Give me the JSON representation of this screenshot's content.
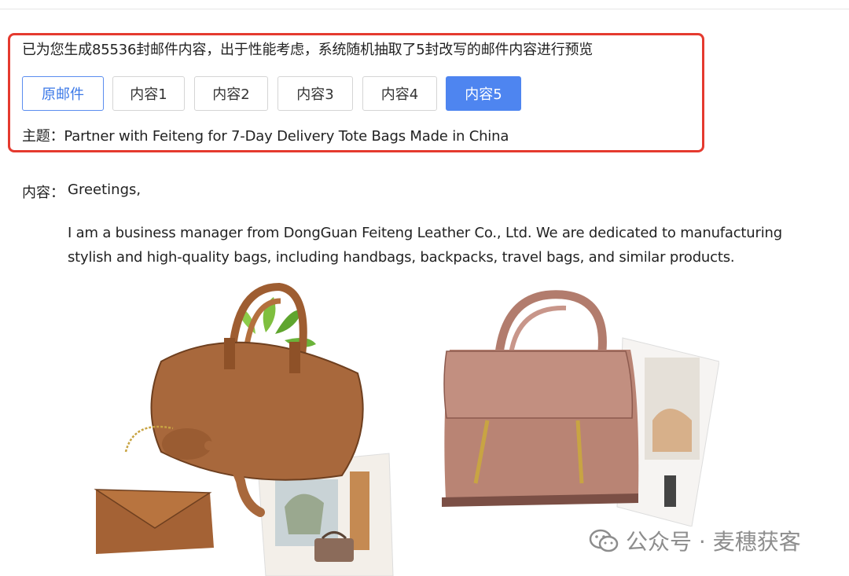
{
  "summary": "已为您生成85536封邮件内容，出于性能考虑，系统随机抽取了5封改写的邮件内容进行预览",
  "tabs": [
    {
      "label": "原邮件",
      "state": "original"
    },
    {
      "label": "内容1",
      "state": "default"
    },
    {
      "label": "内容2",
      "state": "default"
    },
    {
      "label": "内容3",
      "state": "default"
    },
    {
      "label": "内容4",
      "state": "default"
    },
    {
      "label": "内容5",
      "state": "active"
    }
  ],
  "subject": {
    "label": "主题：",
    "value": "Partner with Feiteng for 7-Day Delivery Tote Bags Made in China"
  },
  "email": {
    "content_label": "内容：",
    "greeting": "Greetings,",
    "paragraph": "I am a business manager from DongGuan Feiteng Leather Co., Ltd. We are dedicated to manufacturing stylish and high-quality bags, including handbags, backpacks, travel bags, and similar products."
  },
  "watermark": {
    "text": "公众号 · 麦穗获客",
    "icon": "wechat-icon"
  },
  "colors": {
    "highlight_border": "#e53a2f",
    "active_tab": "#4e85f0",
    "original_tab_text": "#3b78e7",
    "brown_leather": "#a8683c",
    "pink_leather": "#b98474"
  }
}
